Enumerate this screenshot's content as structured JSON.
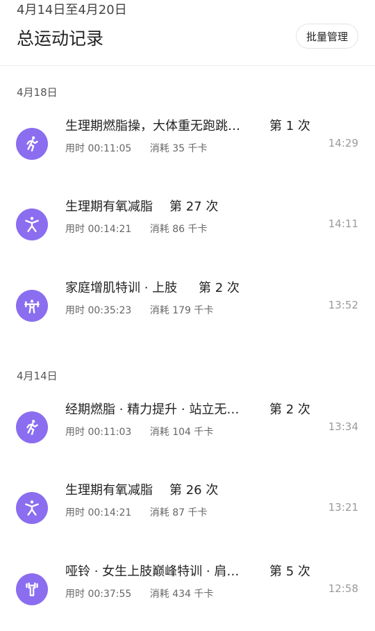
{
  "header": {
    "date_range": "4月14日至4月20日",
    "title": "总运动记录",
    "batch_button": "批量管理"
  },
  "groups": [
    {
      "date": "4月18日",
      "records": [
        {
          "name": "生理期燃脂操，大体重无跑跳…",
          "count": "第 1 次",
          "duration": "用时 00:11:05",
          "calories": "消耗 35 千卡",
          "time": "14:29",
          "icon": "running-figure-icon"
        },
        {
          "name": "生理期有氧减脂",
          "count": "第 27 次",
          "duration": "用时 00:14:21",
          "calories": "消耗 86 千卡",
          "time": "14:11",
          "icon": "star-jump-figure-icon"
        },
        {
          "name": "家庭增肌特训 · 上肢",
          "count": "第 2 次",
          "duration": "用时 00:35:23",
          "calories": "消耗 179 千卡",
          "time": "13:52",
          "icon": "weightlifting-figure-icon"
        }
      ]
    },
    {
      "date": "4月14日",
      "records": [
        {
          "name": "经期燃脂 · 精力提升 · 站立无…",
          "count": "第 2 次",
          "duration": "用时 00:11:03",
          "calories": "消耗 104 千卡",
          "time": "13:34",
          "icon": "running-figure-icon"
        },
        {
          "name": "生理期有氧减脂",
          "count": "第 26 次",
          "duration": "用时 00:14:21",
          "calories": "消耗 87 千卡",
          "time": "13:21",
          "icon": "star-jump-figure-icon"
        },
        {
          "name": "哑铃 · 女生上肢巅峰特训 · 肩…",
          "count": "第 5 次",
          "duration": "用时 00:37:55",
          "calories": "消耗 434 千卡",
          "time": "12:58",
          "icon": "dumbbell-icon"
        }
      ]
    }
  ],
  "colors": {
    "accent": "#8b6df0"
  }
}
